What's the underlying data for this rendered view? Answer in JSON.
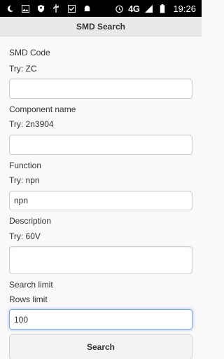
{
  "status_bar": {
    "network": "4G",
    "time": "19:26",
    "icons": [
      "moon-icon",
      "image-icon",
      "shield-icon",
      "usb-icon",
      "check-box-icon",
      "android-icon",
      "alarm-icon",
      "signal-icon",
      "battery-icon"
    ]
  },
  "app_bar": {
    "title": "SMD Search"
  },
  "form": {
    "smd_code": {
      "label": "SMD Code",
      "hint": "Try: ZC",
      "value": ""
    },
    "component_name": {
      "label": "Component name",
      "hint": "Try: 2n3904",
      "value": ""
    },
    "function": {
      "label": "Function",
      "hint": "Try: npn",
      "value": "npn"
    },
    "description": {
      "label": "Description",
      "hint": "Try: 60V",
      "value": ""
    },
    "search_limit": {
      "label": "Search limit",
      "hint": "Rows limit",
      "value": "100"
    },
    "search_button": "Search"
  }
}
